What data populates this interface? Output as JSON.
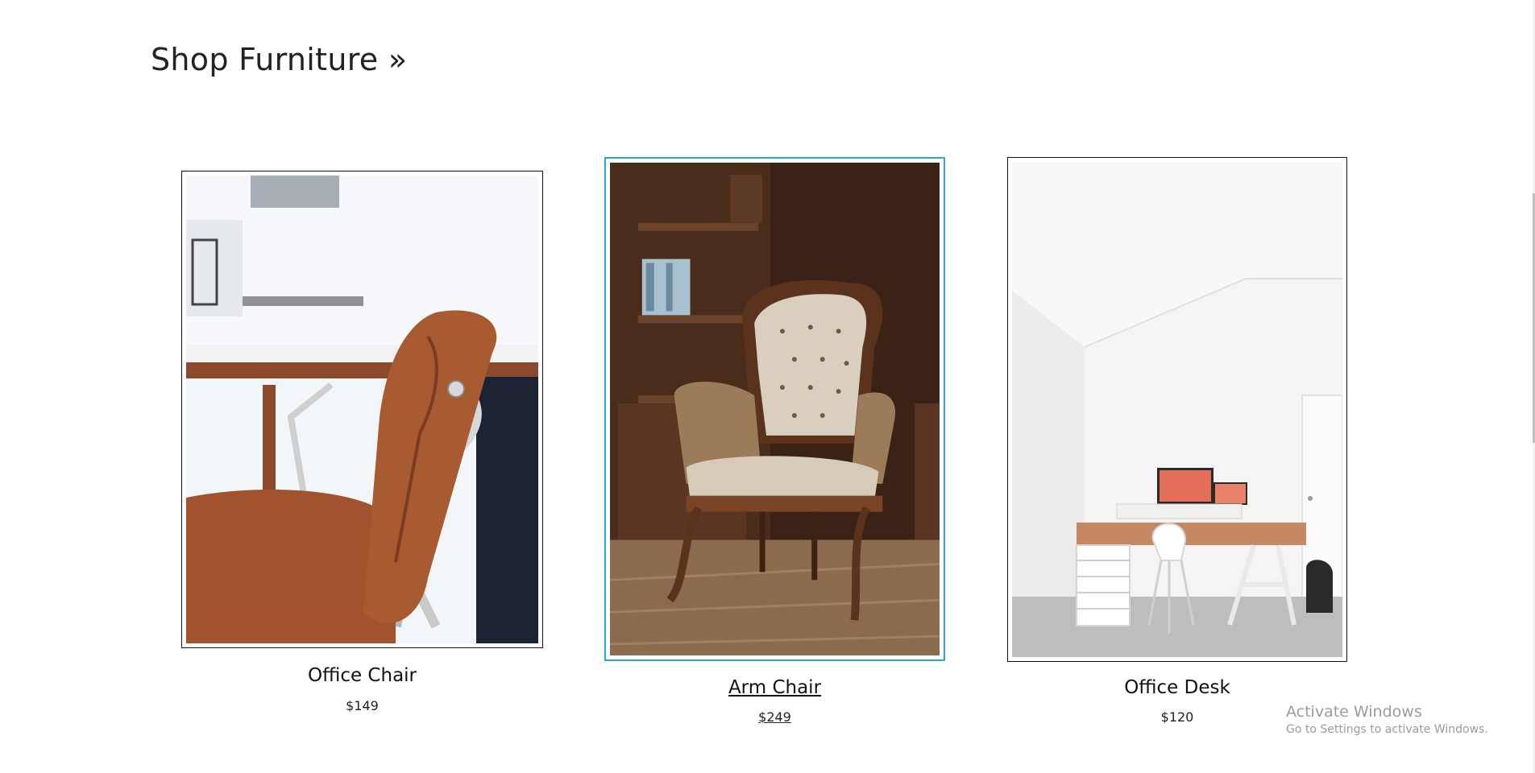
{
  "section": {
    "title": "Shop Furniture »"
  },
  "products": [
    {
      "name": "Office Chair",
      "price": "$149"
    },
    {
      "name": "Arm Chair",
      "price": "$249"
    },
    {
      "name": "Office Desk",
      "price": "$120"
    }
  ],
  "watermark": {
    "line1": "Activate Windows",
    "line2": "Go to Settings to activate Windows."
  },
  "colors": {
    "selection_border": "#29a7de",
    "leather_brown": "#a0532c"
  }
}
